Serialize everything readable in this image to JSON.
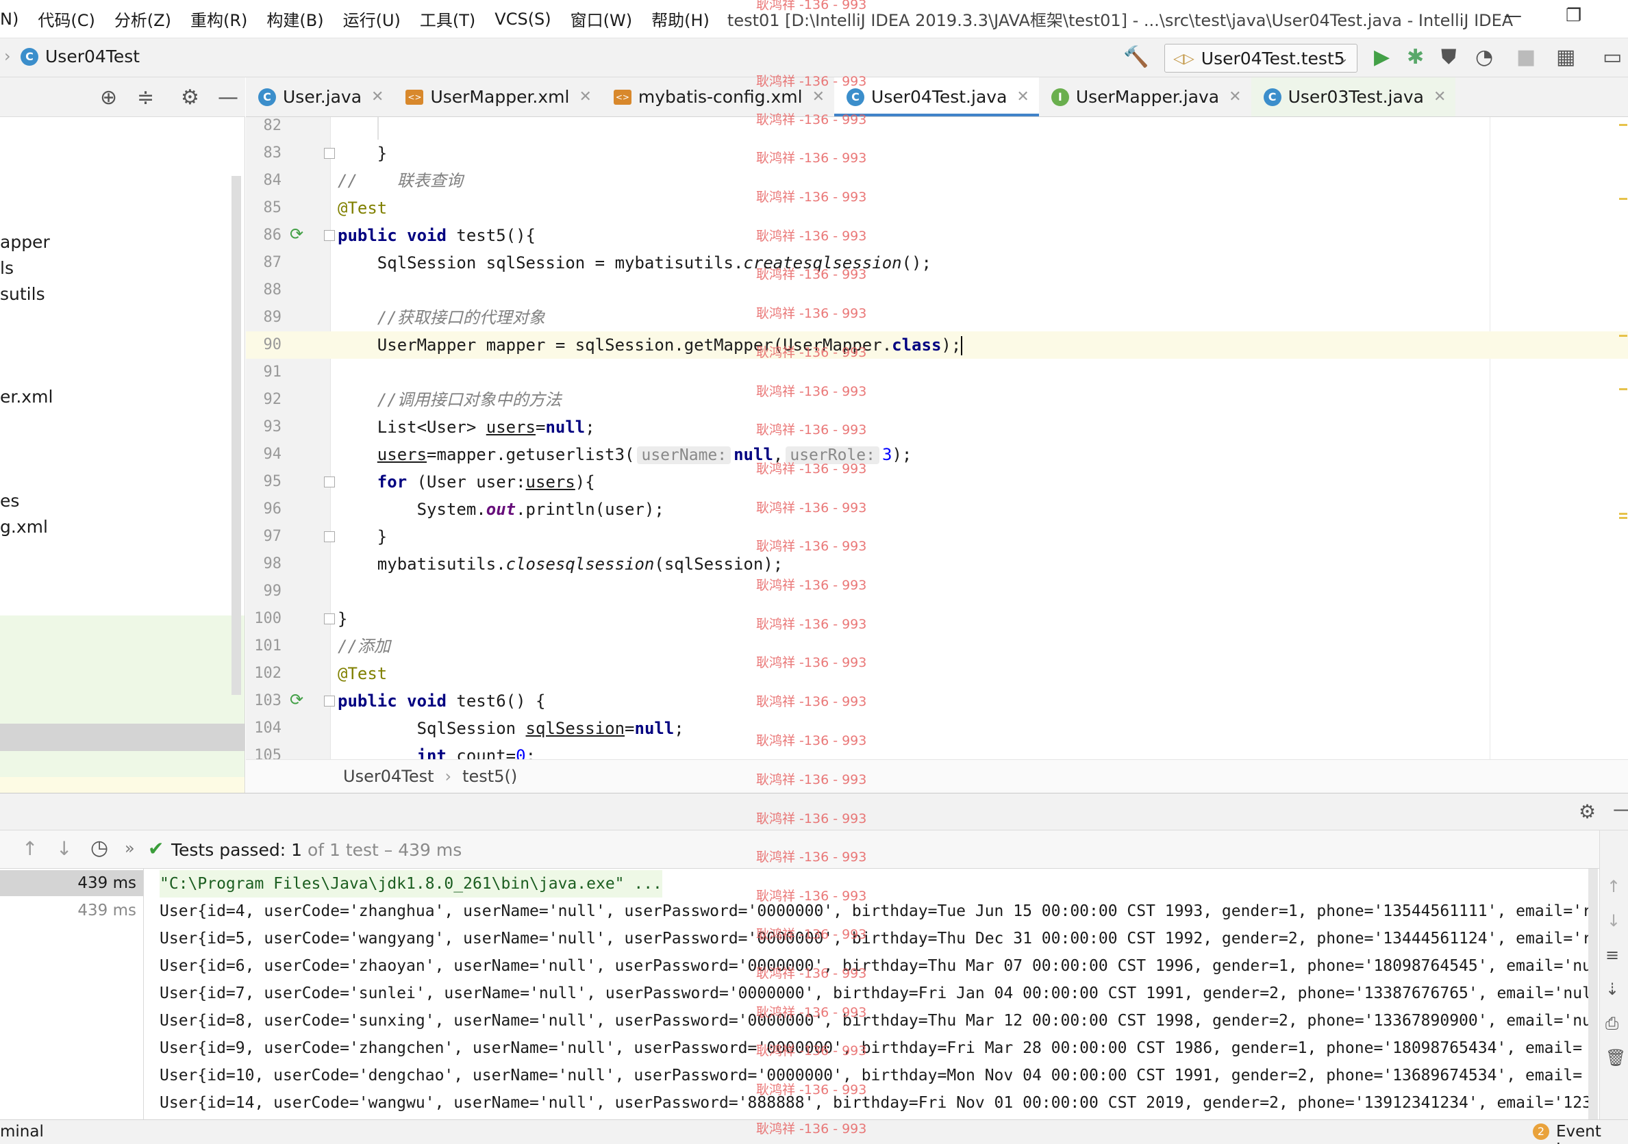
{
  "menu": {
    "items": [
      "N)",
      "代码(C)",
      "分析(Z)",
      "重构(R)",
      "构建(B)",
      "运行(U)",
      "工具(T)",
      "VCS(S)",
      "窗口(W)",
      "帮助(H)"
    ],
    "window_title": "test01 [D:\\IntelliJ IDEA 2019.3.3\\JAVA框架\\test01] - ...\\src\\test\\java\\User04Test.java - IntelliJ IDEA"
  },
  "navbar": {
    "file": "User04Test",
    "run_config": "User04Test.test5"
  },
  "project_tree": {
    "items": [
      "apper",
      "ls",
      "sutils",
      "er.xml",
      "es",
      "g.xml"
    ]
  },
  "tabs": [
    {
      "label": "User.java",
      "icon": "class-icon"
    },
    {
      "label": "UserMapper.xml",
      "icon": "xml-icon"
    },
    {
      "label": "mybatis-config.xml",
      "icon": "xml-icon"
    },
    {
      "label": "User04Test.java",
      "icon": "class-icon",
      "active": true
    },
    {
      "label": "UserMapper.java",
      "icon": "interface-icon"
    },
    {
      "label": "User03Test.java",
      "icon": "class-icon"
    }
  ],
  "code": {
    "line_numbers": [
      "82",
      "83",
      "84",
      "85",
      "86",
      "87",
      "88",
      "89",
      "90",
      "91",
      "92",
      "93",
      "94",
      "95",
      "96",
      "97",
      "98",
      "99",
      "100",
      "101",
      "102",
      "103",
      "104",
      "105"
    ],
    "l83": "    }",
    "l84": "//    联表查询",
    "l85": "@Test",
    "l86_kw": "public void",
    "l86_rest": " test5(){",
    "l87_a": "    SqlSession sqlSession = mybatisutils.",
    "l87_b": "createsqlsession",
    "l87_c": "();",
    "l89": "    //获取接口的代理对象",
    "l90_a": "    UserMapper mapper = sqlSession.getMapper(UserMapper.",
    "l90_kw": "class",
    "l90_c": ");",
    "l92": "    //调用接口对象中的方法",
    "l93_a": "    List<User> ",
    "l93_b": "users",
    "l93_c": "=",
    "l93_kw": "null",
    "l93_d": ";",
    "l94_a": "    ",
    "l94_b": "users",
    "l94_c": "=mapper.getuserlist3(",
    "l94_hint1": "userName:",
    "l94_kw": "null",
    "l94_d": ",",
    "l94_hint2": "userRole:",
    "l94_num": "3",
    "l94_e": ");",
    "l95_kw": "    for",
    "l95_a": " (User user:",
    "l95_b": "users",
    "l95_c": "){",
    "l96_a": "        System.",
    "l96_fld": "out",
    "l96_b": ".println(user);",
    "l97": "    }",
    "l98_a": "    mybatisutils.",
    "l98_b": "closesqlsession",
    "l98_c": "(sqlSession);",
    "l100": "}",
    "l101": "//添加",
    "l102": "@Test",
    "l103_kw": "public void",
    "l103_rest": " test6() {",
    "l104_a": "        SqlSession ",
    "l104_b": "sqlSession",
    "l104_c": "=",
    "l104_kw": "null",
    "l104_d": ";",
    "l105_kw": "        int",
    "l105_a": " count=",
    "l105_num": "0",
    "l105_b": ";"
  },
  "breadcrumb": {
    "class": "User04Test",
    "method": "test5()"
  },
  "run": {
    "status_prefix": "Tests passed:",
    "status_count": "1",
    "status_rest": "of 1 test – 439 ms",
    "tree_times": [
      "439 ms",
      "439 ms"
    ],
    "console": [
      "\"C:\\Program Files\\Java\\jdk1.8.0_261\\bin\\java.exe\" ...",
      "User{id=4, userCode='zhanghua', userName='null', userPassword='0000000', birthday=Tue Jun 15 00:00:00 CST 1993, gender=1, phone='13544561111', email='r",
      "User{id=5, userCode='wangyang', userName='null', userPassword='0000000', birthday=Thu Dec 31 00:00:00 CST 1992, gender=2, phone='13444561124', email='r",
      "User{id=6, userCode='zhaoyan', userName='null', userPassword='0000000', birthday=Thu Mar 07 00:00:00 CST 1996, gender=1, phone='18098764545', email='nu",
      "User{id=7, userCode='sunlei', userName='null', userPassword='0000000', birthday=Fri Jan 04 00:00:00 CST 1991, gender=2, phone='13387676765', email='nul",
      "User{id=8, userCode='sunxing', userName='null', userPassword='0000000', birthday=Thu Mar 12 00:00:00 CST 1998, gender=2, phone='13367890900', email='nu",
      "User{id=9, userCode='zhangchen', userName='null', userPassword='0000000', birthday=Fri Mar 28 00:00:00 CST 1986, gender=1, phone='18098765434', email=",
      "User{id=10, userCode='dengchao', userName='null', userPassword='0000000', birthday=Mon Nov 04 00:00:00 CST 1991, gender=2, phone='13689674534', email=",
      "User{id=14, userCode='wangwu', userName='null', userPassword='888888', birthday=Fri Nov 01 00:00:00 CST 2019, gender=2, phone='13912341234', email='123"
    ]
  },
  "status": {
    "left": "minal",
    "event_count": "2",
    "event_log": "Event Log"
  },
  "watermark": "耿鸿祥 -136 - 993",
  "colors": {
    "accent": "#4083c9",
    "keyword": "#000080",
    "comment": "#808080",
    "annotation": "#808000",
    "run_green": "#43a047",
    "watermark": "#e86a6a"
  }
}
